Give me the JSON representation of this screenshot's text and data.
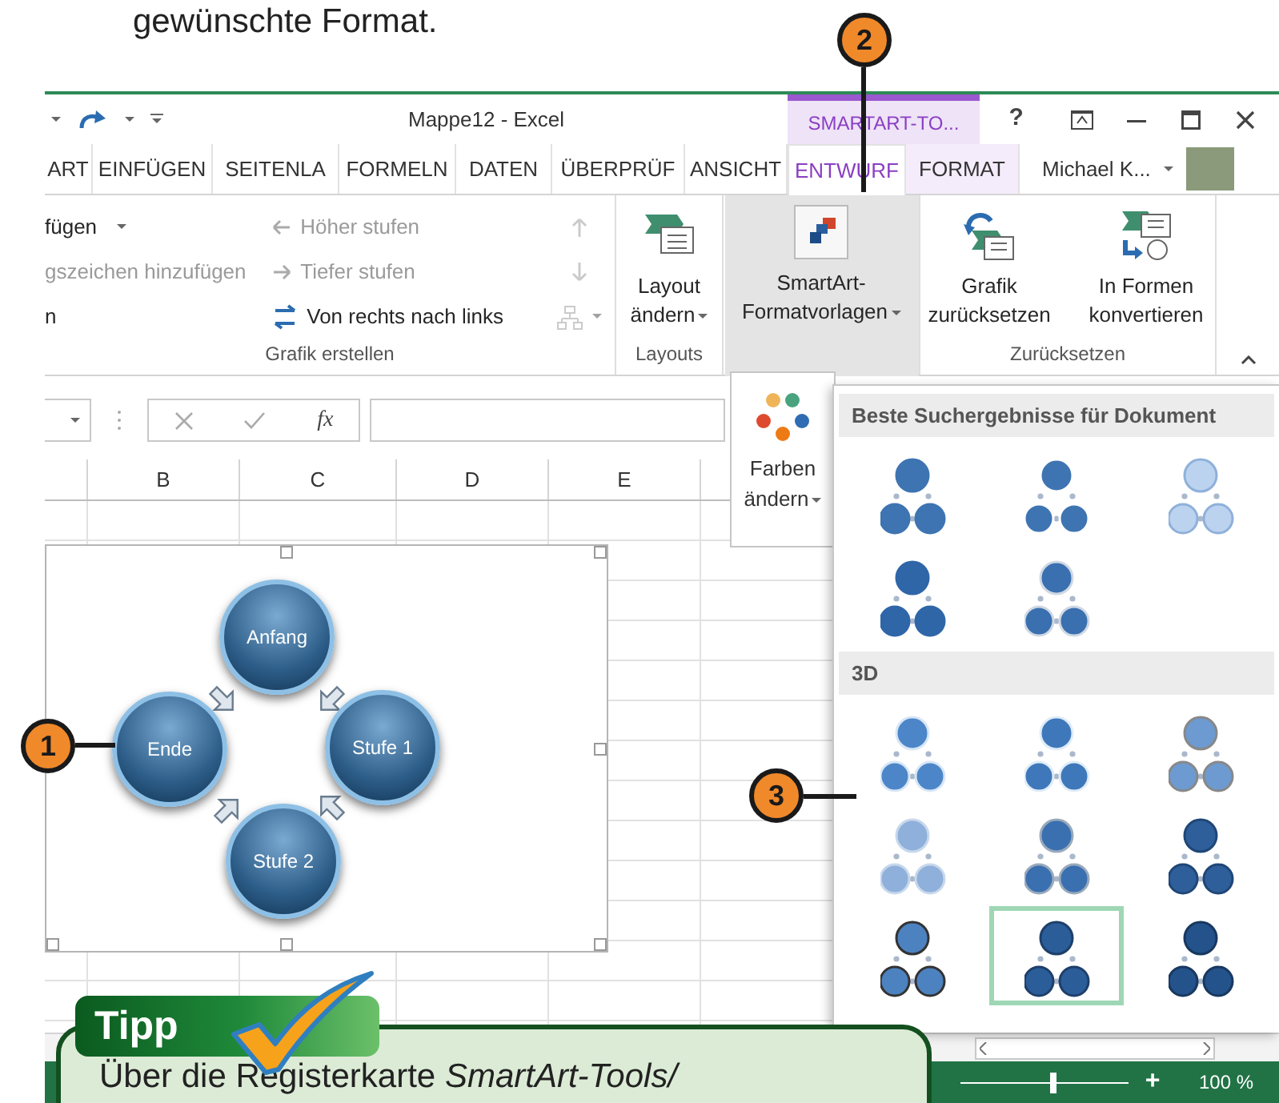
{
  "page_text": "gewünschte Format.",
  "window": {
    "title": "Mappe12 - Excel",
    "contextual_group": "SMARTART-TO...",
    "help": "?"
  },
  "tabs": [
    {
      "label": "ART",
      "selected": false,
      "contextual": false
    },
    {
      "label": "EINFÜGEN",
      "selected": false,
      "contextual": false
    },
    {
      "label": "SEITENLA",
      "selected": false,
      "contextual": false
    },
    {
      "label": "FORMELN",
      "selected": false,
      "contextual": false
    },
    {
      "label": "DATEN",
      "selected": false,
      "contextual": false
    },
    {
      "label": "ÜBERPRÜF",
      "selected": false,
      "contextual": false
    },
    {
      "label": "ANSICHT",
      "selected": false,
      "contextual": false
    },
    {
      "label": "ENTWURF",
      "selected": true,
      "contextual": true
    },
    {
      "label": "FORMAT",
      "selected": false,
      "contextual": true
    }
  ],
  "account": {
    "user": "Michael K..."
  },
  "ribbon": {
    "groups": [
      {
        "kind": "small_commands",
        "label": "Grafik erstellen",
        "items": [
          {
            "label": "fügen",
            "disabled": false,
            "dropdown": true
          },
          {
            "label": "gszeichen hinzufügen",
            "disabled": true,
            "dropdown": false
          },
          {
            "label": "n",
            "disabled": false,
            "dropdown": false
          },
          {
            "label": "Höher stufen",
            "disabled": true,
            "dropdown": false
          },
          {
            "label": "Tiefer stufen",
            "disabled": true,
            "dropdown": false
          },
          {
            "label": "Von rechts nach links",
            "disabled": false,
            "dropdown": false
          }
        ],
        "icon_buttons": [
          {
            "disabled": true,
            "dropdown": false
          },
          {
            "disabled": true,
            "dropdown": false
          },
          {
            "disabled": true,
            "dropdown": true
          }
        ]
      },
      {
        "kind": "large_buttons",
        "label": "Layouts",
        "buttons": [
          {
            "label": "Layout ändern",
            "dropdown": true,
            "pressed": false
          }
        ]
      },
      {
        "kind": "large_buttons",
        "buttons": [
          {
            "label": "SmartArt-Formatvorlagen",
            "dropdown": true,
            "pressed": true
          }
        ]
      },
      {
        "kind": "large_buttons",
        "label": "Zurücksetzen",
        "buttons": [
          {
            "label": "Grafik zurücksetzen",
            "dropdown": false,
            "pressed": false
          },
          {
            "label": "In Formen konvertieren",
            "dropdown": false,
            "pressed": false
          }
        ]
      }
    ]
  },
  "formula_bar": {
    "function_label": "fx"
  },
  "sheet": {
    "columns": [
      "B",
      "C",
      "D",
      "E"
    ]
  },
  "smartart": {
    "nodes": [
      "Anfang",
      "Stufe 1",
      "Stufe 2",
      "Ende"
    ]
  },
  "color_menu": {
    "label": "Farben ändern",
    "dropdown": true
  },
  "style_gallery": {
    "sections": [
      {
        "title": "Beste Suchergebnisse für Dokument",
        "items": [
          {
            "selected": false
          },
          {
            "selected": false
          },
          {
            "selected": false
          },
          {
            "selected": false
          },
          {
            "selected": false
          }
        ]
      },
      {
        "title": "3D",
        "items": [
          {
            "selected": false
          },
          {
            "selected": false
          },
          {
            "selected": false
          },
          {
            "selected": false
          },
          {
            "selected": false
          },
          {
            "selected": false
          },
          {
            "selected": false
          },
          {
            "selected": true
          },
          {
            "selected": false
          }
        ]
      }
    ]
  },
  "status_bar": {
    "zoom_in": "+",
    "zoom": {
      "level": 0.55,
      "reading": "100 %"
    }
  },
  "callouts": [
    "1",
    "2",
    "3"
  ],
  "tip": {
    "title": "Tipp",
    "text": "Über die Registerkarte *SmartArt-Tools/*"
  }
}
